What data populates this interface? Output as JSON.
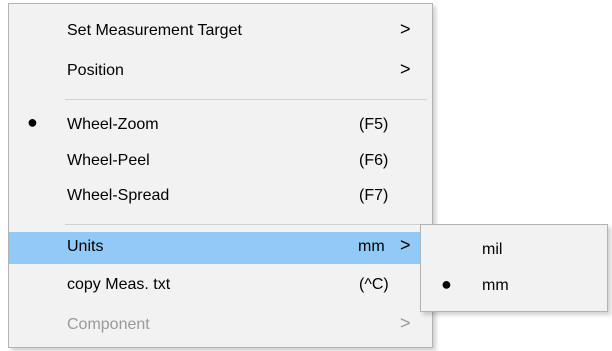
{
  "menu": {
    "items": [
      {
        "label": "Set Measurement Target",
        "arrow": ">"
      },
      {
        "label": "Position",
        "arrow": ">"
      },
      {
        "label": "Wheel-Zoom",
        "shortcut": "(F5)",
        "bullet": "●"
      },
      {
        "label": "Wheel-Peel",
        "shortcut": "(F6)"
      },
      {
        "label": "Wheel-Spread",
        "shortcut": "(F7)"
      },
      {
        "label": "Units",
        "value": "mm",
        "arrow": ">"
      },
      {
        "label": "copy Meas. txt",
        "shortcut": "(^C)"
      },
      {
        "label": "Component",
        "arrow": ">"
      }
    ]
  },
  "submenu": {
    "items": [
      {
        "label": "mil"
      },
      {
        "label": "mm",
        "bullet": "●"
      }
    ]
  },
  "colors": {
    "highlight": "#91c9f7",
    "menu_bg": "#f2f2f2",
    "disabled_text": "#9a9a9a"
  }
}
